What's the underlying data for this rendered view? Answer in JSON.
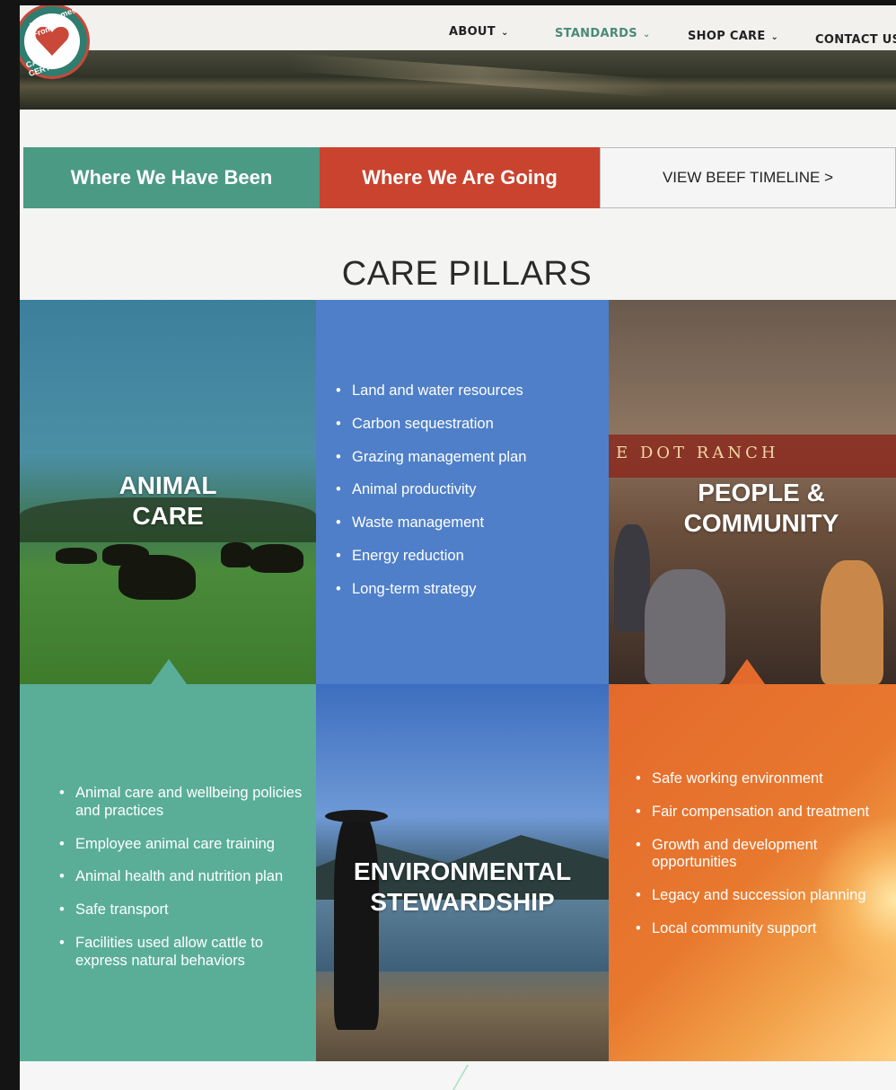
{
  "logo": {
    "text_top": "Food Comes From",
    "text_bottom": "CARE CERTIFIED"
  },
  "nav": {
    "items": [
      {
        "label": "ABOUT"
      },
      {
        "label": "STANDARDS"
      },
      {
        "label": "SHOP CARE"
      },
      {
        "label": "CONTACT US"
      }
    ]
  },
  "tabs": {
    "been": "Where We Have Been",
    "going": "Where We Are Going",
    "timeline": "VIEW BEEF TIMELINE >"
  },
  "section_title": "CARE PILLARS",
  "pillars": {
    "animal_care": {
      "title_line1": "ANIMAL",
      "title_line2": "CARE",
      "items": [
        "Animal care and wellbeing policies and practices",
        "Employee animal care training",
        "Animal health and nutrition plan",
        "Safe transport",
        "Facilities used allow cattle to express natural behaviors"
      ]
    },
    "environmental": {
      "title_line1": "ENVIRONMENTAL",
      "title_line2": "STEWARDSHIP",
      "items": [
        "Land and water resources",
        "Carbon sequestration",
        "Grazing management plan",
        "Animal productivity",
        "Waste management",
        "Energy reduction",
        "Long-term strategy"
      ]
    },
    "people": {
      "title_line1": "PEOPLE &",
      "title_line2": "COMMUNITY",
      "items": [
        "Safe working environment",
        "Fair compensation and treatment",
        "Growth and development opportunities",
        "Legacy and succession planning",
        "Local community support"
      ]
    }
  },
  "restaurant_sign": "E DOT RANCH",
  "colors": {
    "teal": "#4b9a84",
    "red": "#c9432f",
    "blue": "#4f7fc8",
    "orange": "#e46a2c"
  }
}
